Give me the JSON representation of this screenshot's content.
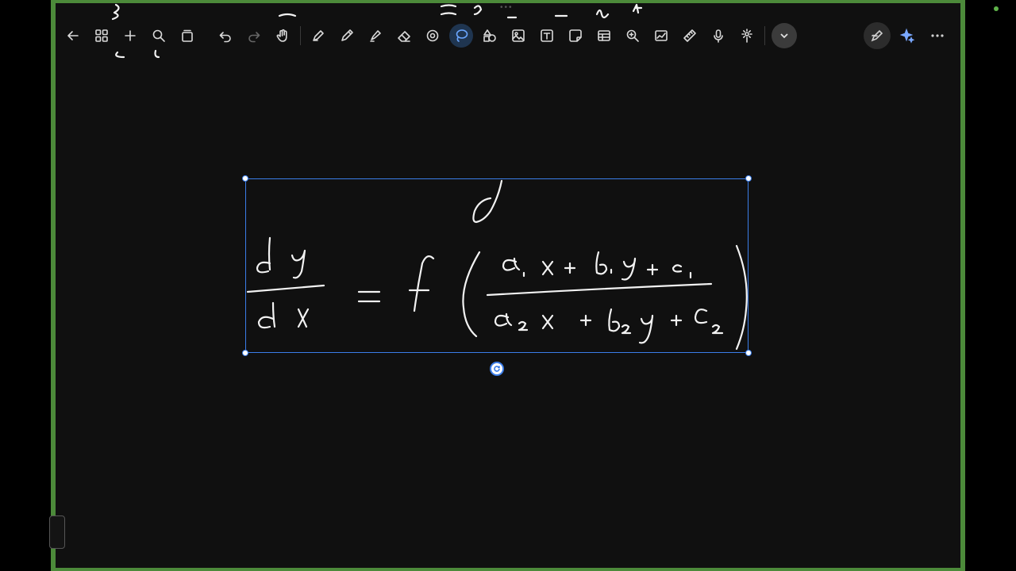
{
  "toolbar": {
    "left": [
      "back-icon",
      "grid-icon",
      "add-icon",
      "search-icon",
      "pages-icon"
    ],
    "history": [
      "undo-icon",
      "redo-icon",
      "hand-icon"
    ],
    "tools": [
      "pen-icon",
      "pencil-icon",
      "highlighter-icon",
      "eraser-icon",
      "shape-recognition-icon",
      "lasso-icon",
      "shapes-icon",
      "image-icon",
      "text-icon",
      "sticky-note-icon",
      "table-icon",
      "zoom-icon",
      "chart-icon",
      "ruler-icon",
      "microphone-icon",
      "laser-pointer-icon"
    ],
    "active_tool": "lasso-icon",
    "more_tools": "chevron-down-icon"
  },
  "right_tools": [
    "handwriting-icon",
    "ai-sparkle-icon",
    "more-icon"
  ],
  "colors": {
    "frame": "#4c8a3a",
    "canvas": "#101010",
    "selection": "#3b7de8",
    "ink": "#f2f2f2",
    "accent": "#6aa6ff"
  }
}
